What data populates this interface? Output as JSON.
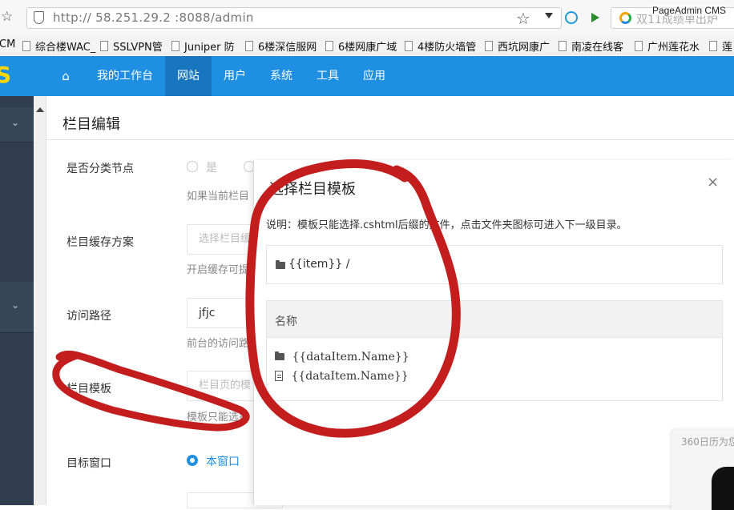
{
  "browser": {
    "url": "http:// 58.251.29.2 :8088/admin",
    "search_text": "双11成绩单出炉",
    "tab_title": "PageAdmin CMS",
    "bookmarks": [
      "CM",
      "综合楼WAC_",
      "SSLVPN管",
      "Juniper 防",
      "6楼深信服网",
      "6楼网康广域",
      "4楼防火墙管",
      "西坑网康广",
      "南凌在线客",
      "广州莲花水",
      "莲"
    ]
  },
  "topnav": {
    "logo": "S",
    "items": [
      "我的工作台",
      "网站",
      "用户",
      "系统",
      "工具",
      "应用"
    ],
    "active": "网站"
  },
  "page": {
    "title": "栏目编辑",
    "fields": {
      "is_category_label": "是否分类节点",
      "is_category_opt_yes": "是",
      "is_category_hint": "如果当前栏目",
      "cache_label": "栏目缓存方案",
      "cache_placeholder": "选择栏目缓",
      "cache_hint": "开启缓存可提",
      "path_label": "访问路径",
      "path_value": "jfjc",
      "path_hint": "前台的访问路",
      "template_label": "栏目模板",
      "template_placeholder": "栏目页的模",
      "template_hint": "模板只能选择",
      "target_label": "目标窗口",
      "target_opt": "本窗口"
    }
  },
  "modal": {
    "title": "选择栏目模板",
    "close": "×",
    "description": "说明：模板只能选择.cshtml后缀的文件，点击文件夹图标可进入下一级目录。",
    "path": "{{item}} /",
    "table_header": "名称",
    "rows": [
      {
        "icon": "folder-icon",
        "name": "{{dataItem.Name}}"
      },
      {
        "icon": "file-icon",
        "name": "{{dataItem.Name}}"
      }
    ]
  },
  "popup": {
    "text": "360日历为您"
  },
  "colors": {
    "nav_bg": "#1e8fe1",
    "nav_active": "#1776bd",
    "sidebar": "#2f3d4f",
    "annotation": "#c41d1d"
  }
}
